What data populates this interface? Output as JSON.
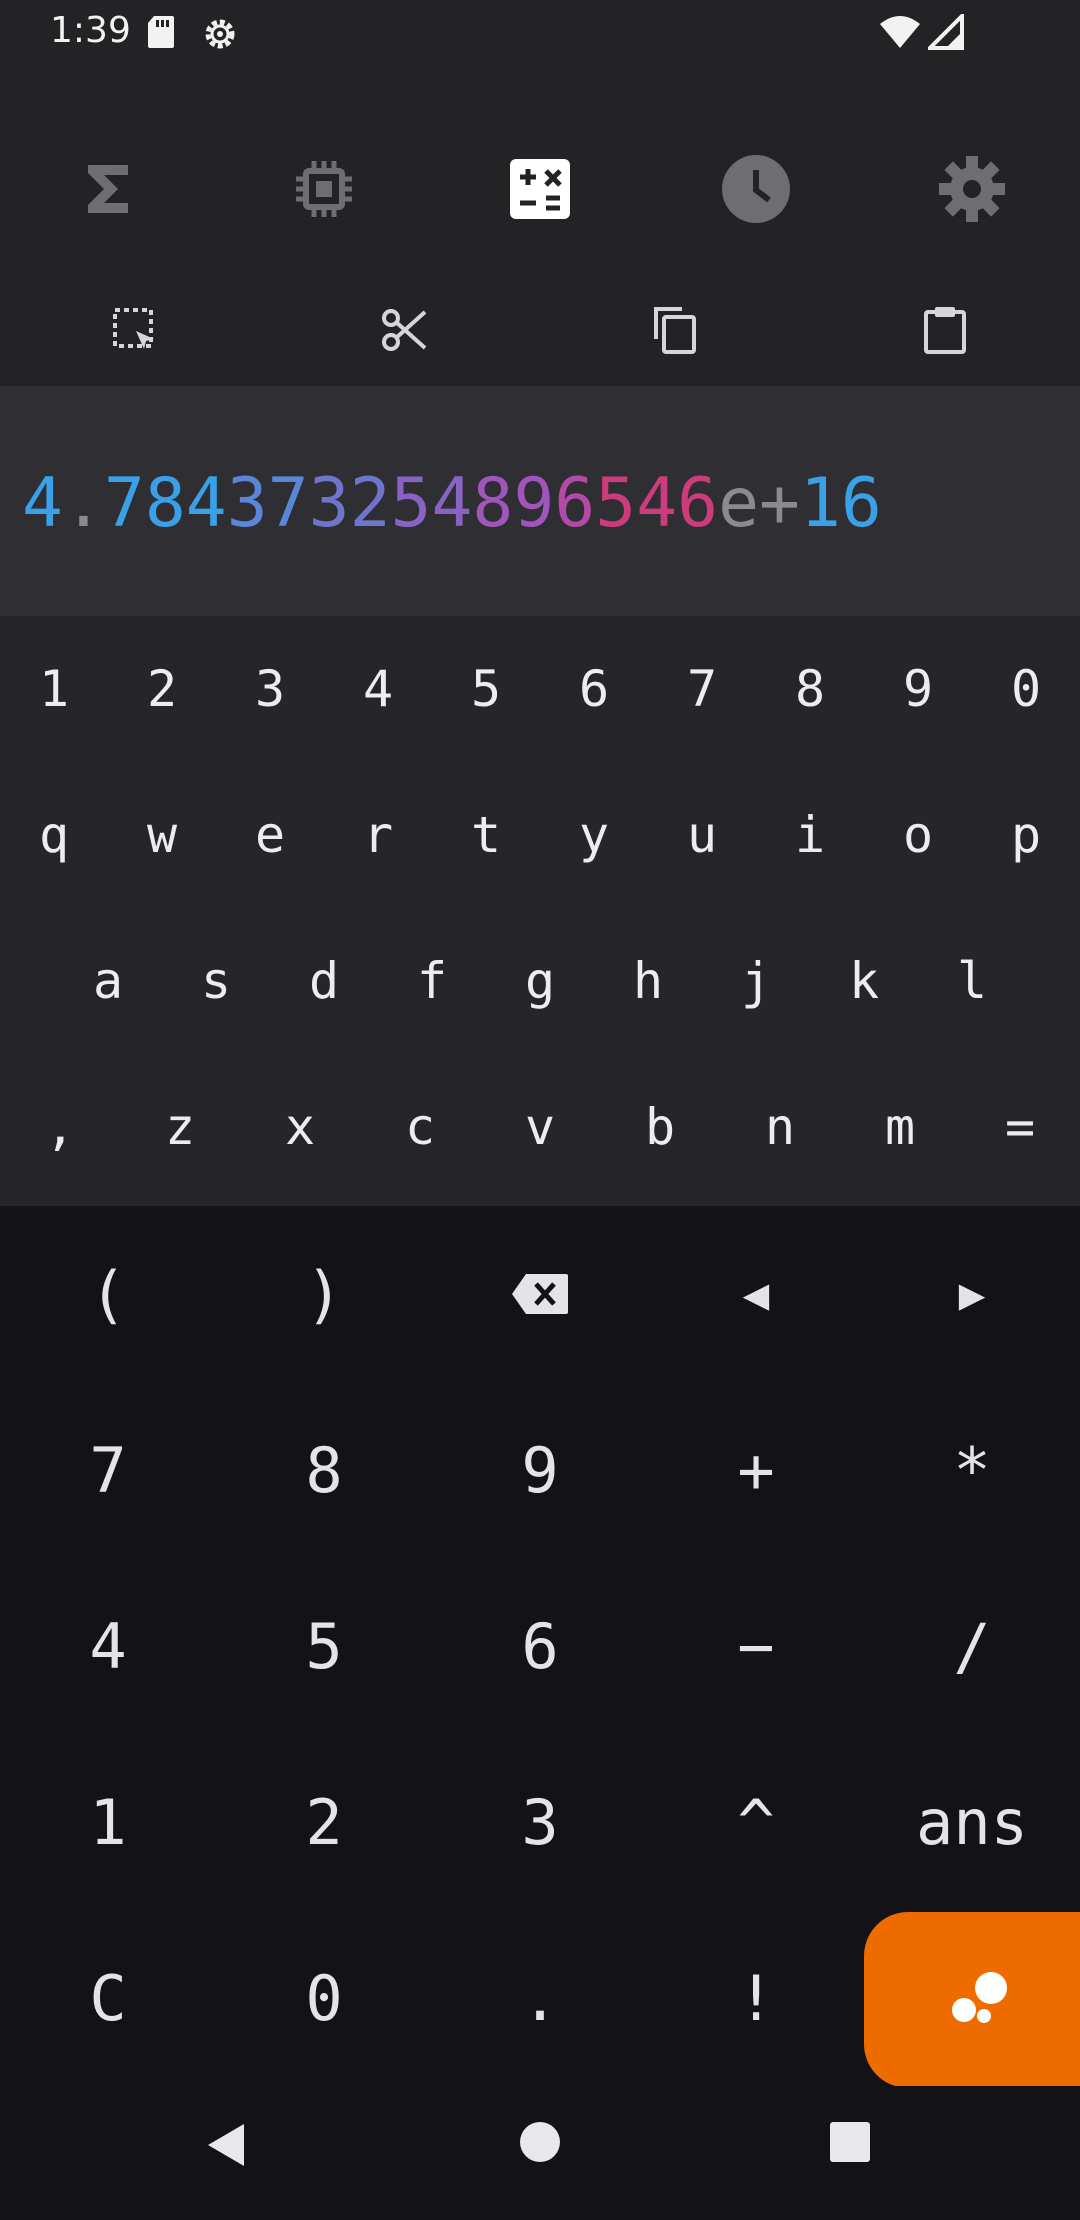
{
  "status": {
    "time": "1:39"
  },
  "nav": {
    "tabs": [
      {
        "name": "functions-tab",
        "icon": "sigma-icon",
        "active": false
      },
      {
        "name": "hardware-tab",
        "icon": "chip-icon",
        "active": false
      },
      {
        "name": "calculator-tab",
        "icon": "calculator-icon",
        "active": true
      },
      {
        "name": "history-tab",
        "icon": "clock-icon",
        "active": false
      },
      {
        "name": "settings-tab",
        "icon": "gear-icon",
        "active": false
      }
    ]
  },
  "toolbar": {
    "tools": [
      "select-all-icon",
      "cut-icon",
      "copy-icon",
      "paste-icon"
    ]
  },
  "display": {
    "segments": [
      {
        "text": "4",
        "color": "#3aa0e8"
      },
      {
        "text": ".",
        "color": "#8a8a90"
      },
      {
        "text": "784",
        "color": "#3aa0e8"
      },
      {
        "text": "37",
        "color": "#5b86d8"
      },
      {
        "text": "32",
        "color": "#6f74cc"
      },
      {
        "text": "54",
        "color": "#8863c4"
      },
      {
        "text": "89",
        "color": "#a055ba"
      },
      {
        "text": "6",
        "color": "#b24aa8"
      },
      {
        "text": "546",
        "color": "#cc3c7c"
      },
      {
        "text": "e+",
        "color": "#8a8a90"
      },
      {
        "text": "16",
        "color": "#3aa0e8"
      }
    ]
  },
  "keyboard": {
    "row1": [
      "1",
      "2",
      "3",
      "4",
      "5",
      "6",
      "7",
      "8",
      "9",
      "0"
    ],
    "row2": [
      "q",
      "w",
      "e",
      "r",
      "t",
      "y",
      "u",
      "i",
      "o",
      "p"
    ],
    "row3": [
      "a",
      "s",
      "d",
      "f",
      "g",
      "h",
      "j",
      "k",
      "l"
    ],
    "row4": [
      ",",
      "z",
      "x",
      "c",
      "v",
      "b",
      "n",
      "m",
      "="
    ]
  },
  "pad": {
    "row1": [
      "(",
      ")",
      "",
      "◀",
      "▶"
    ],
    "row2": [
      "7",
      "8",
      "9",
      "+",
      "*"
    ],
    "row3": [
      "4",
      "5",
      "6",
      "−",
      "/"
    ],
    "row4": [
      "1",
      "2",
      "3",
      "^",
      "ans"
    ],
    "row5": [
      "C",
      "0",
      ".",
      "!"
    ]
  },
  "colors": {
    "accent": "#ee6b00",
    "active_icon": "#ffffff",
    "inactive_icon": "#6e6e72"
  }
}
